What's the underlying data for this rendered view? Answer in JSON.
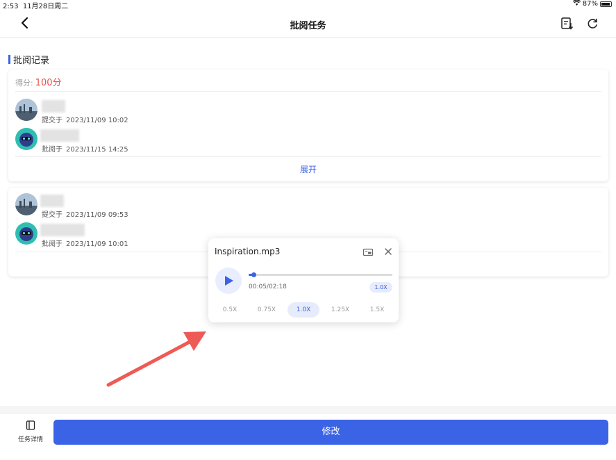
{
  "status_bar": {
    "time": "2:53",
    "date": "11月28日周二",
    "battery": "87%",
    "icons": [
      "wifi-icon",
      "battery-icon"
    ]
  },
  "nav": {
    "title": "批阅任务",
    "icons": [
      "back-icon",
      "document-download-icon",
      "refresh-icon"
    ]
  },
  "section": {
    "title": "批阅记录",
    "accent_color": "#3b63e6"
  },
  "card1": {
    "score_label": "得分:",
    "score_value": "100分",
    "records": [
      {
        "action": "提交于",
        "time": "2023/11/09 10:02"
      },
      {
        "action": "批阅于",
        "time": "2023/11/15 14:25"
      }
    ],
    "expand_label": "展开"
  },
  "card2": {
    "records": [
      {
        "action": "提交于",
        "time": "2023/11/09 09:53"
      },
      {
        "action": "批阅于",
        "time": "2023/11/09 10:01"
      }
    ]
  },
  "player": {
    "filename": "Inspiration.mp3",
    "current_time": "00:05/02:18",
    "progress": 0.036,
    "speed": "1.0X",
    "speed_options": [
      "0.5X",
      "0.75X",
      "1.0X",
      "1.25X",
      "1.5X"
    ],
    "active_speed_index": 2
  },
  "bottom": {
    "task_detail_label": "任务详情",
    "edit_label": "修改"
  },
  "colors": {
    "accent": "#3b63e6",
    "score": "#f04a4a",
    "annotation_arrow": "#ee5a55"
  }
}
